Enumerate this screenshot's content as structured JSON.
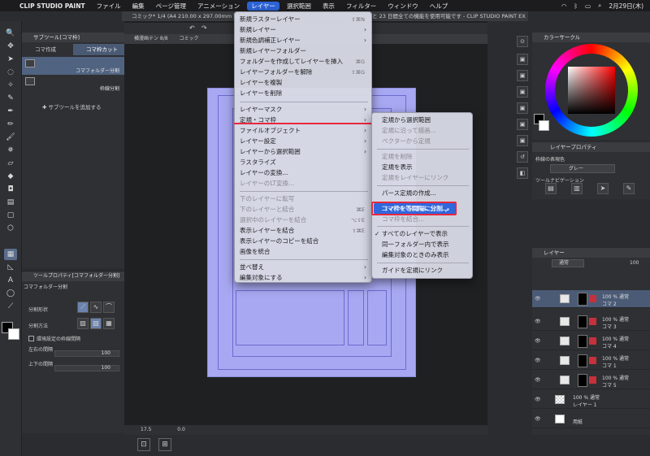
{
  "menubar": {
    "app": "CLIP STUDIO PAINT",
    "items": [
      "ファイル",
      "編集",
      "ページ管理",
      "アニメーション",
      "レイヤー",
      "選択範囲",
      "表示",
      "フィルター",
      "ウィンドウ",
      "ヘルプ"
    ],
    "active_index": 4,
    "date": "2月29日(木)"
  },
  "window": {
    "title": "コミック* 1/4 (A4 210.00 x 297.00mm 製本サ",
    "trial_notice": "と 23 日間全ての機能を使用可能です - CLIP STUDIO PAINT EX",
    "tab_label": "コミック",
    "view_label": "横漫画テン 8/8",
    "zoom": "17.5",
    "angle": "0.0"
  },
  "subtool_panel": {
    "title": "サブツール[コマ枠]",
    "tabs": [
      "コマ作成",
      "コマ枠カット"
    ],
    "items": [
      {
        "label": "コマフォルダー分割"
      },
      {
        "label": "枠線分割"
      }
    ],
    "add_label": "サブツールを追加する"
  },
  "tool_property": {
    "title": "ツールプロパティ[コマフォルダー分割]",
    "tool_name": "コマフォルダー分割",
    "rows": {
      "shape": "分割形状",
      "method": "分割方法",
      "env_checkbox": "環境設定の枠線間隔",
      "lr_gap": "左右の間隔",
      "tb_gap": "上下の間隔",
      "lr_value": "100",
      "tb_value": "100"
    }
  },
  "main_menu": {
    "items": [
      {
        "label": "新規ラスターレイヤー",
        "shortcut": "⇧⌘N",
        "y": 0
      },
      {
        "label": "新規レイヤー",
        "arrow": true,
        "y": 1
      },
      {
        "label": "新規色調補正レイヤー",
        "arrow": true,
        "y": 2
      },
      {
        "label": "新規レイヤーフォルダー",
        "y": 3
      },
      {
        "label": "フォルダーを作成してレイヤーを挿入",
        "shortcut": "⌘G",
        "y": 4
      },
      {
        "label": "レイヤーフォルダーを解除",
        "shortcut": "⇧⌘G",
        "y": 5
      },
      {
        "label": "レイヤーを複製",
        "y": 6
      },
      {
        "label": "レイヤーを削除",
        "y": 7
      },
      {
        "label": "レイヤーマスク",
        "arrow": true,
        "y": 8
      },
      {
        "label": "定規・コマ枠",
        "arrow": true,
        "y": 9
      },
      {
        "label": "ファイルオブジェクト",
        "arrow": true,
        "y": 10
      },
      {
        "label": "レイヤー設定",
        "arrow": true,
        "y": 11
      },
      {
        "label": "レイヤーから選択範囲",
        "arrow": true,
        "y": 12
      },
      {
        "label": "ラスタライズ",
        "y": 13
      },
      {
        "label": "レイヤーの変換...",
        "y": 14
      },
      {
        "label": "レイヤーのLT変換...",
        "disabled": true,
        "y": 15
      },
      {
        "label": "下のレイヤーに転写",
        "disabled": true,
        "y": 16
      },
      {
        "label": "下のレイヤーと結合",
        "shortcut": "⌘E",
        "disabled": true,
        "y": 17
      },
      {
        "label": "選択中のレイヤーを結合",
        "shortcut": "⌥⇧E",
        "disabled": true,
        "y": 18
      },
      {
        "label": "表示レイヤーを結合",
        "shortcut": "⇧⌘E",
        "y": 19
      },
      {
        "label": "表示レイヤーのコピーを結合",
        "y": 20
      },
      {
        "label": "画像を統合",
        "y": 21
      },
      {
        "label": "並べ替え",
        "arrow": true,
        "y": 22
      },
      {
        "label": "編集対象にする",
        "arrow": true,
        "y": 23
      }
    ]
  },
  "sub_menu": {
    "items": [
      {
        "label": "定規から選択範囲",
        "disabled": false
      },
      {
        "label": "定規に沿って描画...",
        "disabled": true
      },
      {
        "label": "ベクターから定規",
        "disabled": true
      },
      {
        "label": "定規を削除",
        "disabled": true
      },
      {
        "label": "定規を表示",
        "disabled": false
      },
      {
        "label": "定規をレイヤーにリンク",
        "disabled": true
      },
      {
        "label": "パース定規の作成...",
        "disabled": false
      },
      {
        "label": "コマ枠を等間隔に分割...",
        "highlight": true
      },
      {
        "label": "コマ枠を結合...",
        "disabled": true
      },
      {
        "label": "すべてのレイヤーで表示",
        "checked": true
      },
      {
        "label": "同一フォルダー内で表示",
        "disabled": false
      },
      {
        "label": "編集対象のときのみ表示",
        "disabled": false
      },
      {
        "label": "ガイドを定規にリンク",
        "disabled": false
      }
    ]
  },
  "color_panel": {
    "title": "カラーサークル",
    "accent": "#ff1e1e"
  },
  "layer_property": {
    "title": "レイヤープロパティ",
    "effect_label": "枠線の表現色",
    "color_value": "グレー",
    "nav_label": "ツールナビゲーション"
  },
  "layer_panel": {
    "title": "レイヤー",
    "blend": "通常",
    "opacity": "100",
    "rows": [
      {
        "mode": "100 % 通常",
        "name": "コマ 2",
        "selected": true
      },
      {
        "mode": "100 % 通常",
        "name": "コマ 3"
      },
      {
        "mode": "100 % 通常",
        "name": "コマ 4"
      },
      {
        "mode": "100 % 通常",
        "name": "コマ 1"
      },
      {
        "mode": "100 % 通常",
        "name": "コマ 5"
      },
      {
        "mode": "100 % 通常",
        "name": "レイヤー 1"
      },
      {
        "mode": "",
        "name": "用紙"
      }
    ]
  }
}
